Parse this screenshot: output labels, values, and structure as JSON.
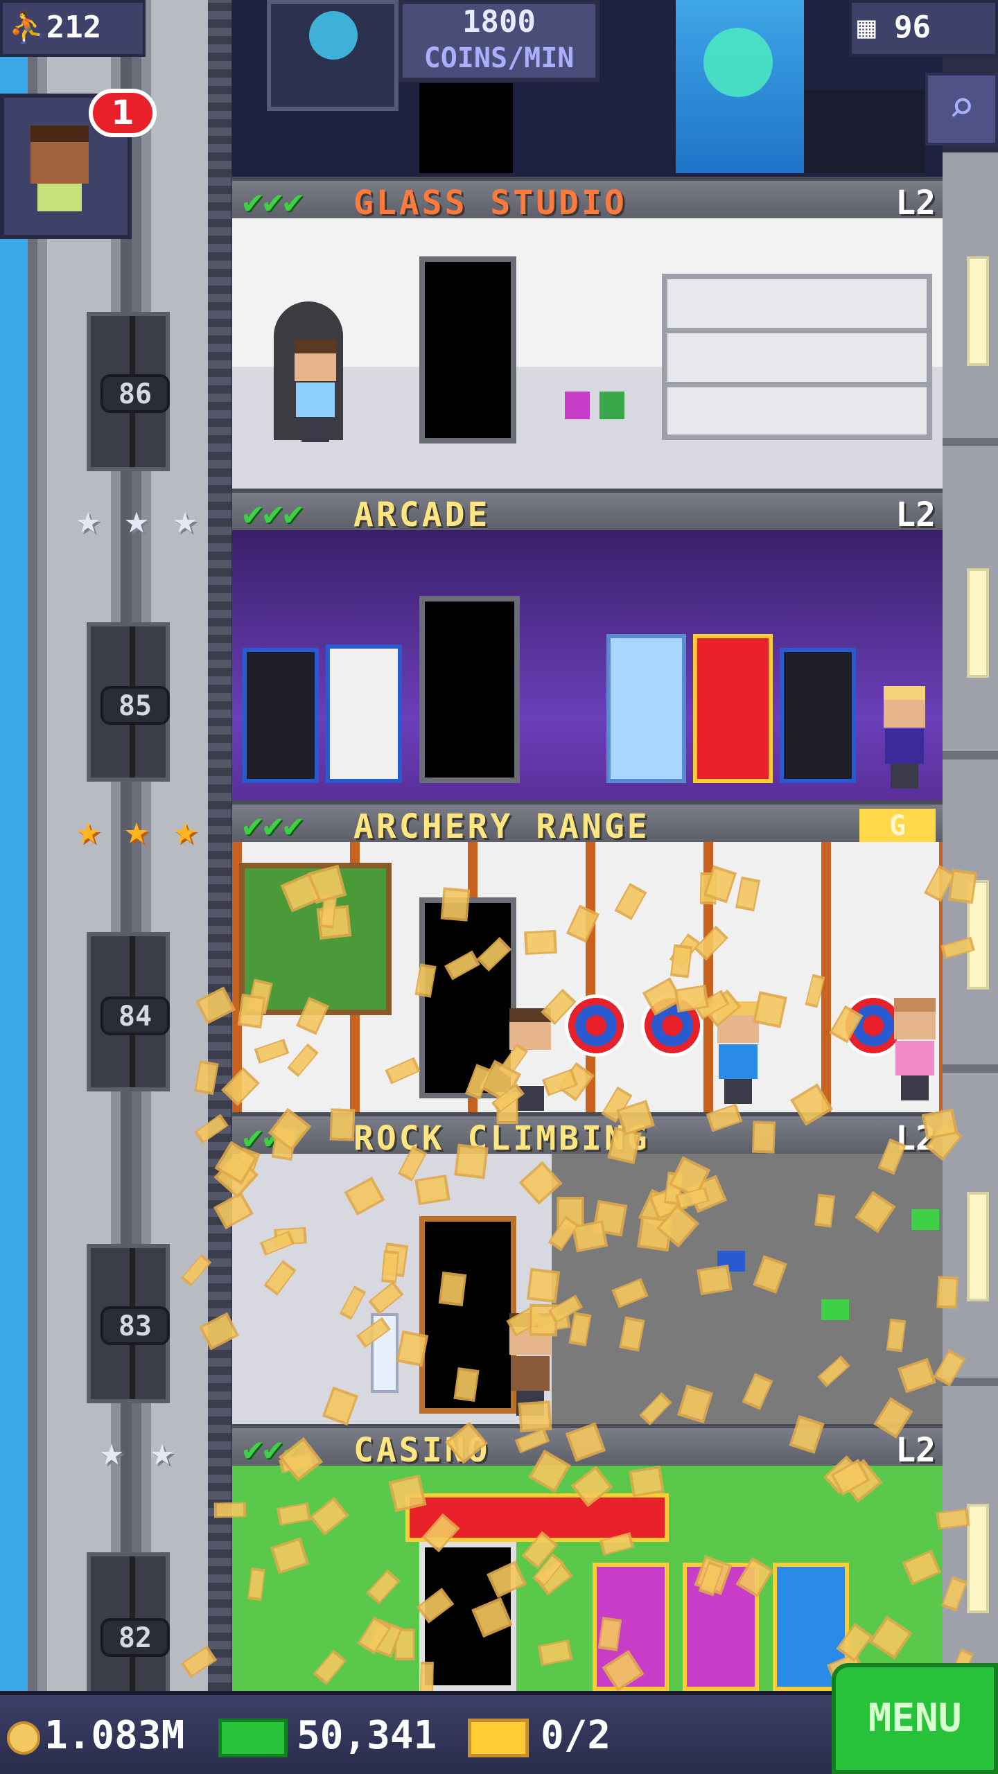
{
  "top": {
    "population": "212",
    "floor_count": "96",
    "coins_rate_value": "1800",
    "coins_rate_unit": "COINS/MIN",
    "notification_count": "1"
  },
  "floors": [
    {
      "name": "GLASS STUDIO",
      "level": "L2",
      "number": "86",
      "stars": 3,
      "name_color": "#ff7a3c"
    },
    {
      "name": "ARCADE",
      "level": "L2",
      "number": "85",
      "stars": 3,
      "name_color": "#ffe680"
    },
    {
      "name": "ARCHERY RANGE",
      "level": "G",
      "number": "84",
      "stars": 3,
      "name_color": "#ffe680"
    },
    {
      "name": "ROCK CLIMBING",
      "level": "L2",
      "number": "83",
      "stars": 2,
      "name_color": "#ffe680"
    },
    {
      "name": "CASINO",
      "level": "L2",
      "number": "82",
      "stars": 0,
      "name_color": "#ffe680"
    }
  ],
  "star_rows": [
    {
      "type": "silver",
      "count": 3
    },
    {
      "type": "gold",
      "count": 3
    },
    {
      "type": "silver",
      "count": 2
    }
  ],
  "bottom": {
    "coins": "1.083M",
    "bux": "50,341",
    "tickets": "0/2",
    "menu_label": "MENU"
  },
  "colors": {
    "accent_green": "#27c23a",
    "check_green": "#3ed146",
    "coin_gold": "#f4c860",
    "ui_purple": "#3e4168"
  },
  "icons": [
    "person-icon",
    "building-icon",
    "search-icon",
    "coin-icon",
    "bux-icon",
    "ticket-icon",
    "check-icon",
    "star-icon"
  ]
}
